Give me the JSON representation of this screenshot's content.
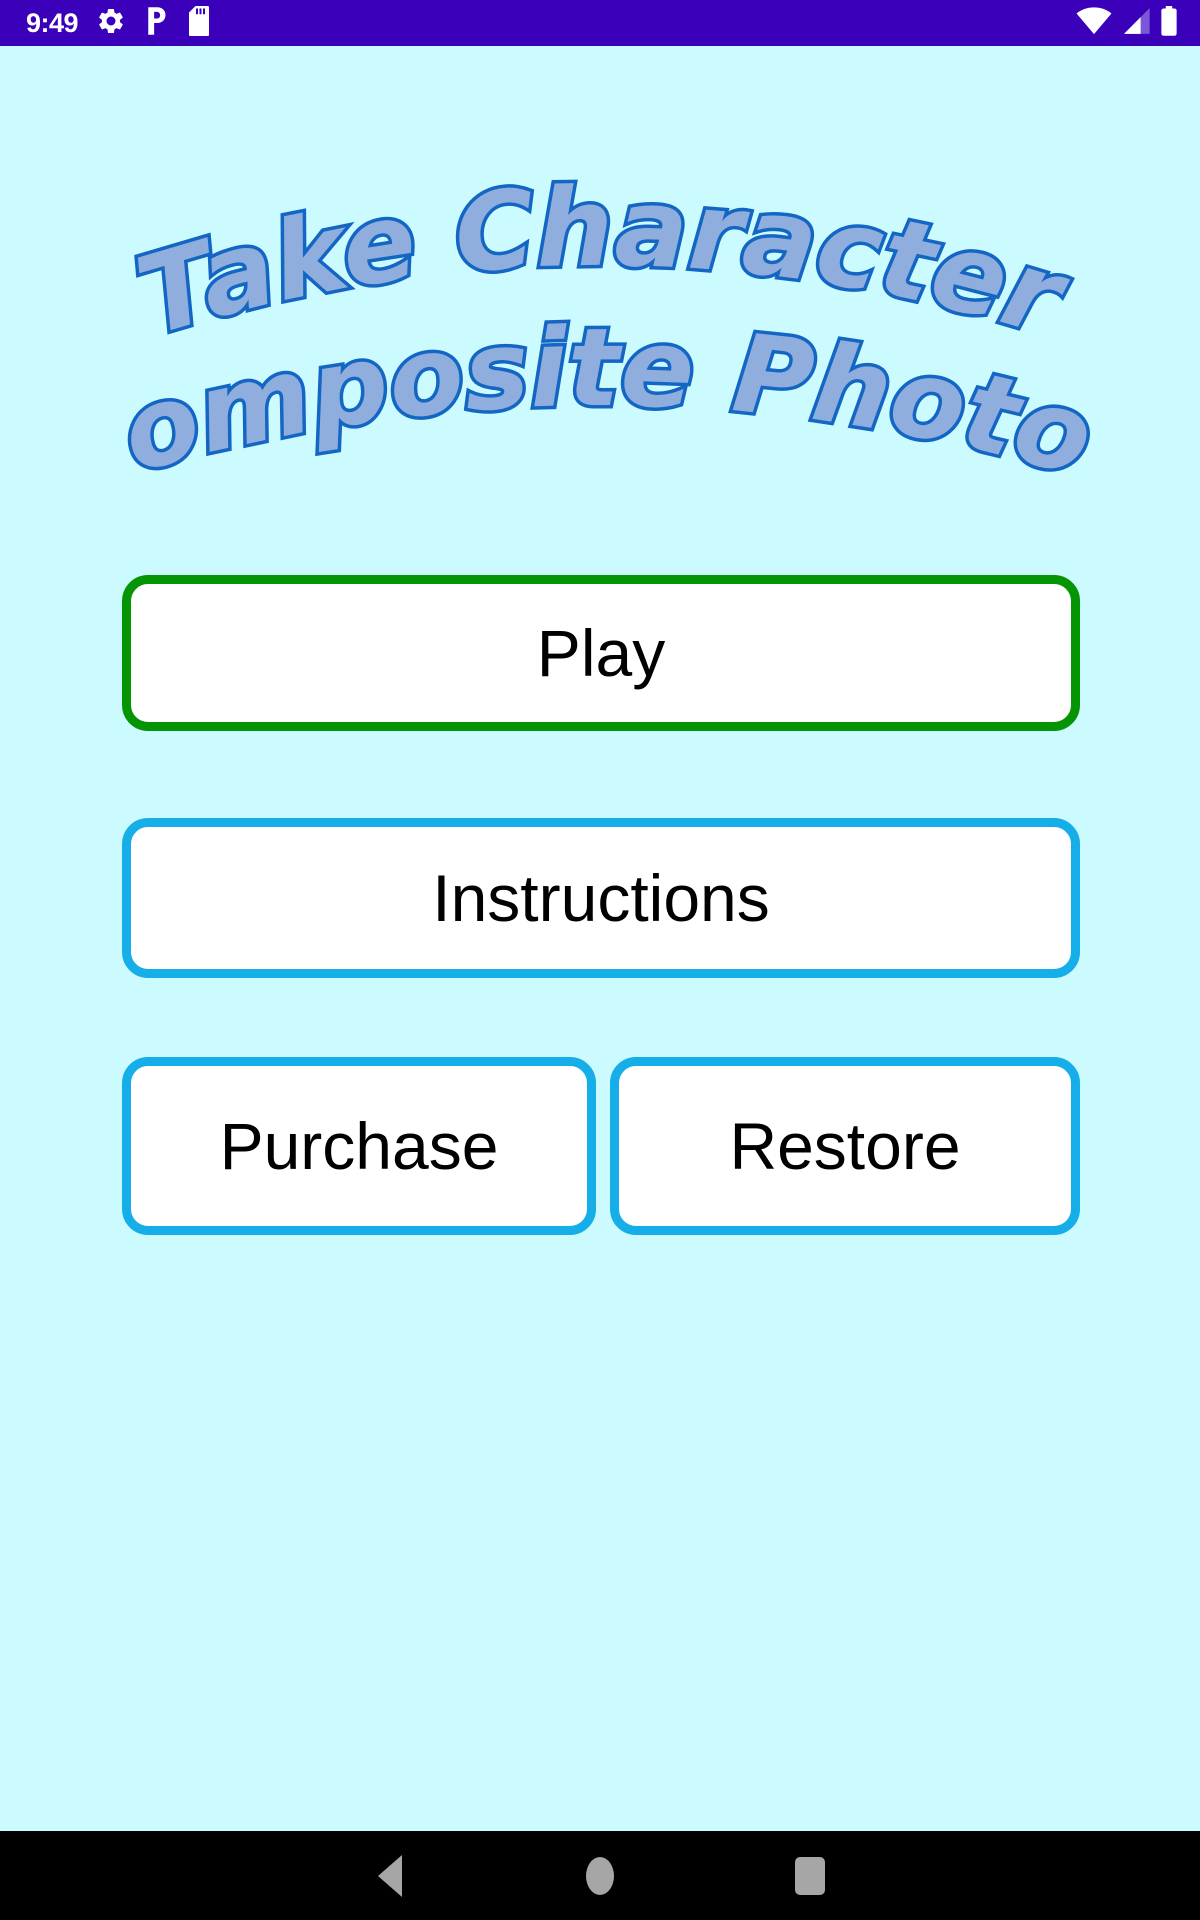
{
  "status_bar": {
    "time": "9:49",
    "background_color": "#3B00B9",
    "icons": [
      {
        "name": "gear-icon",
        "label": "Settings"
      },
      {
        "name": "p-letter-icon",
        "label": "P"
      },
      {
        "name": "sd-card-icon",
        "label": "SD card"
      }
    ],
    "right_icons": [
      {
        "name": "wifi-icon",
        "label": "Wi-Fi"
      },
      {
        "name": "cellular-signal-icon",
        "label": "Cellular signal"
      },
      {
        "name": "battery-icon",
        "label": "Battery"
      }
    ]
  },
  "screen": {
    "background_color": "#CCFBFF"
  },
  "title": {
    "line1": "Take Character",
    "line2": "Composite Photos",
    "full": "Take Character Composite Photos",
    "fill_color": "#8FAEDD",
    "outline_color": "#1366C4"
  },
  "buttons": {
    "play": {
      "label": "Play",
      "border_color": "#049404",
      "background_color": "#FFFFFF",
      "text_color": "#000000"
    },
    "instructions": {
      "label": "Instructions",
      "border_color": "#16AEE8",
      "background_color": "#FFFFFF",
      "text_color": "#000000"
    },
    "purchase": {
      "label": "Purchase",
      "border_color": "#16AEE8",
      "background_color": "#FFFFFF",
      "text_color": "#000000"
    },
    "restore": {
      "label": "Restore",
      "border_color": "#16AEE8",
      "background_color": "#FFFFFF",
      "text_color": "#000000"
    }
  },
  "nav_bar": {
    "background_color": "#000000",
    "icon_color": "#A6A6A6",
    "items": [
      {
        "name": "back-button",
        "label": "Back"
      },
      {
        "name": "home-button",
        "label": "Home"
      },
      {
        "name": "recent-apps-button",
        "label": "Recent apps"
      }
    ]
  }
}
